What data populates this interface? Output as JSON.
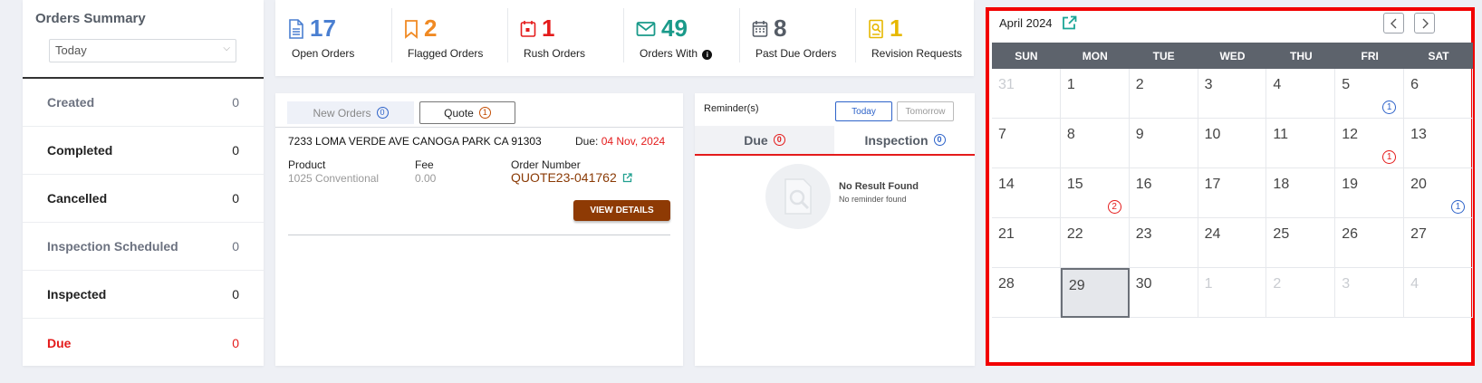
{
  "summary": {
    "title": "Orders Summary",
    "period": "Today",
    "rows": [
      {
        "label": "Created",
        "value": "0"
      },
      {
        "label": "Completed",
        "value": "0"
      },
      {
        "label": "Cancelled",
        "value": "0"
      },
      {
        "label": "Inspection Scheduled",
        "value": "0"
      },
      {
        "label": "Inspected",
        "value": "0"
      },
      {
        "label": "Due",
        "value": "0"
      }
    ]
  },
  "stats": [
    {
      "count": "17",
      "label": "Open Orders",
      "icon": "document-icon",
      "color": "#4a7fd1"
    },
    {
      "count": "2",
      "label": "Flagged Orders",
      "icon": "bookmark-icon",
      "color": "#f08a24"
    },
    {
      "count": "1",
      "label": "Rush Orders",
      "icon": "calendar-alert-icon",
      "color": "#e41b1b"
    },
    {
      "count": "49",
      "label": "Orders With",
      "icon": "envelope-icon",
      "color": "#1a9a8a"
    },
    {
      "count": "8",
      "label": "Past Due Orders",
      "icon": "calendar-icon",
      "color": "#555c66"
    },
    {
      "count": "1",
      "label": "Revision Requests",
      "icon": "search-doc-icon",
      "color": "#e6b800"
    }
  ],
  "orders": {
    "tab_new": "New Orders",
    "tab_new_count": "0",
    "tab_quote": "Quote",
    "tab_quote_count": "1",
    "address": "7233 LOMA VERDE AVE CANOGA PARK CA 91303",
    "due_label": "Due:",
    "due_date": "04 Nov, 2024",
    "product_label": "Product",
    "product_value": "1025 Conventional",
    "fee_label": "Fee",
    "fee_value": "0.00",
    "order_number_label": "Order Number",
    "order_number": "QUOTE23-041762",
    "view_details": "VIEW DETAILS"
  },
  "reminders": {
    "title": "Reminder(s)",
    "today": "Today",
    "tomorrow": "Tomorrow",
    "tab_due": "Due",
    "tab_due_count": "0",
    "tab_inspection": "Inspection",
    "tab_inspection_count": "0",
    "empty_title": "No Result Found",
    "empty_sub": "No reminder found"
  },
  "calendar": {
    "title": "April 2024",
    "weekdays": [
      "SUN",
      "MON",
      "TUE",
      "WED",
      "THU",
      "FRI",
      "SAT"
    ],
    "weeks": [
      [
        {
          "d": "31",
          "o": true
        },
        {
          "d": "1"
        },
        {
          "d": "2"
        },
        {
          "d": "3"
        },
        {
          "d": "4"
        },
        {
          "d": "5",
          "b": "1",
          "c": "#2e63c9"
        },
        {
          "d": "6"
        }
      ],
      [
        {
          "d": "7"
        },
        {
          "d": "8"
        },
        {
          "d": "9"
        },
        {
          "d": "10"
        },
        {
          "d": "11"
        },
        {
          "d": "12",
          "b": "1",
          "c": "#e41b1b"
        },
        {
          "d": "13"
        }
      ],
      [
        {
          "d": "14"
        },
        {
          "d": "15",
          "b": "2",
          "c": "#e41b1b"
        },
        {
          "d": "16"
        },
        {
          "d": "17"
        },
        {
          "d": "18"
        },
        {
          "d": "19"
        },
        {
          "d": "20",
          "b": "1",
          "c": "#2e63c9"
        }
      ],
      [
        {
          "d": "21"
        },
        {
          "d": "22"
        },
        {
          "d": "23"
        },
        {
          "d": "24"
        },
        {
          "d": "25"
        },
        {
          "d": "26"
        },
        {
          "d": "27"
        }
      ],
      [
        {
          "d": "28"
        },
        {
          "d": "29",
          "today": true
        },
        {
          "d": "30"
        },
        {
          "d": "1",
          "o": true
        },
        {
          "d": "2",
          "o": true
        },
        {
          "d": "3",
          "o": true
        },
        {
          "d": "4",
          "o": true
        }
      ]
    ]
  }
}
